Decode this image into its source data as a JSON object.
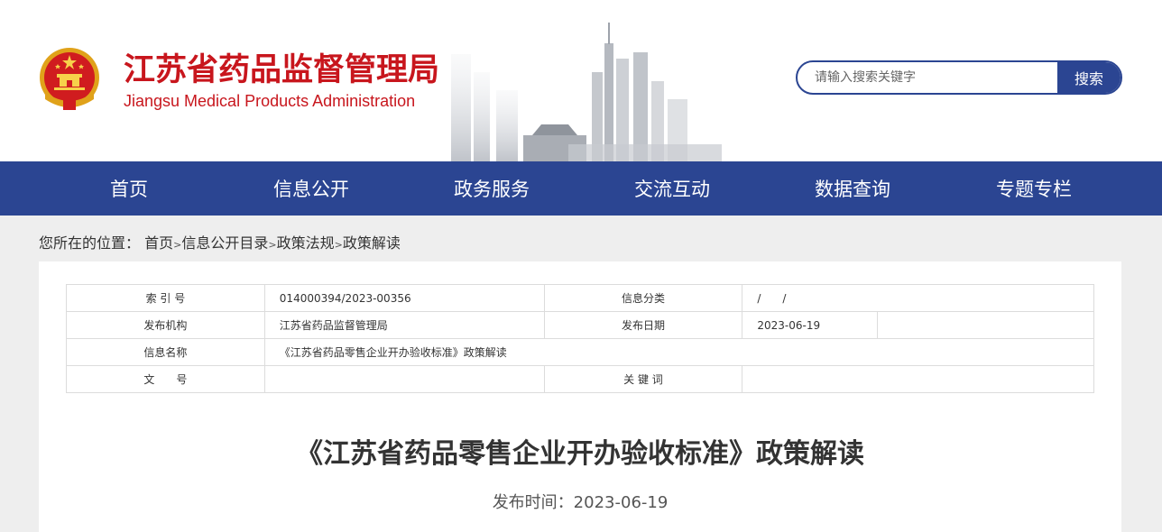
{
  "header": {
    "title_cn": "江苏省药品监督管理局",
    "title_en": "Jiangsu Medical Products Administration",
    "search_placeholder": "请输入搜索关键字",
    "search_button": "搜索"
  },
  "nav": {
    "items": [
      "首页",
      "信息公开",
      "政务服务",
      "交流互动",
      "数据查询",
      "专题专栏"
    ]
  },
  "breadcrumb": {
    "prefix": "您所在的位置：",
    "items": [
      "首页",
      "信息公开目录",
      "政策法规",
      "政策解读"
    ],
    "separator": ">"
  },
  "meta": {
    "index_label": "索 引 号",
    "index_value": "014000394/2023-00356",
    "category_label": "信息分类",
    "category_value": "/　　/",
    "org_label": "发布机构",
    "org_value": "江苏省药品监督管理局",
    "date_label": "发布日期",
    "date_value": "2023-06-19",
    "name_label": "信息名称",
    "name_value": "《江苏省药品零售企业开办验收标准》政策解读",
    "doc_label": "文　　号",
    "doc_value": "",
    "keyword_label": "关 键 词",
    "keyword_value": ""
  },
  "article": {
    "title": "《江苏省药品零售企业开办验收标准》政策解读",
    "publish_time": "发布时间：2023-06-19"
  },
  "colors": {
    "brand_red": "#c8161d",
    "nav_blue": "#2b4592"
  }
}
